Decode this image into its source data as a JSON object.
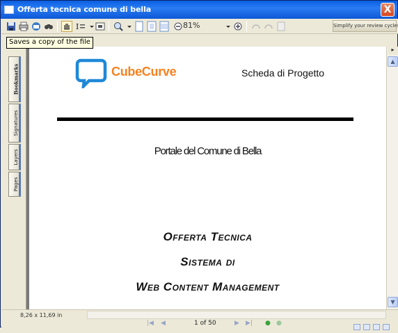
{
  "window": {
    "title": "Offerta tecnica comune di bella",
    "close_label": "X"
  },
  "toolbar": {
    "icons": [
      "save-icon",
      "print-icon",
      "email-icon",
      "search-icon",
      "hand-tool-icon",
      "select-text-icon",
      "snapshot-icon",
      "zoom-in-icon",
      "actual-size-icon",
      "fit-page-icon",
      "fit-width-icon",
      "zoom-out-icon",
      "zoom-in-plus-icon",
      "rotate-icon",
      "rotate-icon",
      "read-icon"
    ],
    "zoom_value": "81%",
    "review_button": "Simplify your review cycles"
  },
  "tooltip": "Saves a copy of the file",
  "sidebar": {
    "tabs": [
      "Bookmarks",
      "Signatures",
      "Layers",
      "Pages"
    ],
    "active_tab": "Bookmarks"
  },
  "document": {
    "logo_text": "CubeCurve",
    "header_right": "Scheda di Progetto",
    "subtitle": "Portale del Comune di Bella",
    "heading_line1": "Offerta Tecnica",
    "heading_line2": "Sistema di",
    "heading_line3": "Web Content Management",
    "logo_color": "#f58220",
    "logo_shape_color": "#1e88d8"
  },
  "status": {
    "page_size": "8,26 x 11,69 in",
    "page_indicator": "1 of 50"
  }
}
